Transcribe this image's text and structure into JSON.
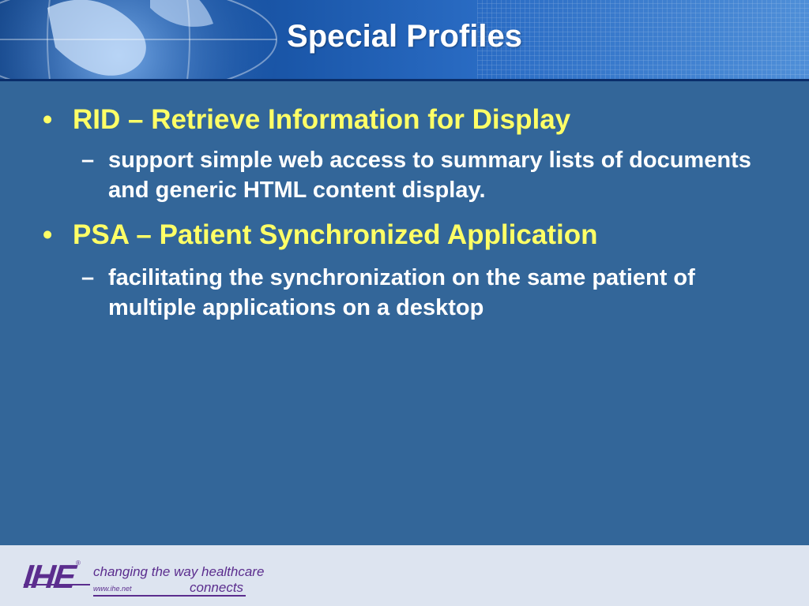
{
  "slide": {
    "title": "Special Profiles",
    "items": [
      {
        "heading": "RID – Retrieve Information for Display",
        "sub": "support simple web access to summary lists of documents and generic HTML content display."
      },
      {
        "heading": "PSA – Patient Synchronized Application",
        "sub": "facilitating the synchronization on the same patient of multiple applications on a desktop"
      }
    ],
    "bullet": "•",
    "dash": "–"
  },
  "footer": {
    "logo_text": "IHE",
    "registered": "®",
    "slogan": "changing the way healthcare",
    "url": "www.ihe.net",
    "connects": "connects"
  },
  "colors": {
    "background": "#336699",
    "heading": "#ffff66",
    "subtext": "#ffffff",
    "logo": "#5b2d8e"
  }
}
